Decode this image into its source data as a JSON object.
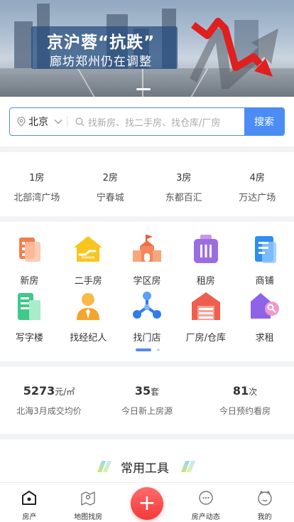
{
  "banner": {
    "headline": "京沪蓉“抗跌”",
    "subline": "廊坊郑州仍在调整"
  },
  "search": {
    "city": "北京",
    "placeholder": "找新房、找二手房、找仓库/厂房",
    "button": "搜索"
  },
  "hot": [
    {
      "rank": "1房",
      "name": "北部湾广场"
    },
    {
      "rank": "2房",
      "name": "宁春城"
    },
    {
      "rank": "3房",
      "name": "东都百汇"
    },
    {
      "rank": "4房",
      "name": "万达广场"
    }
  ],
  "categories": [
    {
      "label": "新房",
      "icon": "new-house-icon"
    },
    {
      "label": "二手房",
      "icon": "second-hand-house-icon"
    },
    {
      "label": "学区房",
      "icon": "school-district-icon"
    },
    {
      "label": "租房",
      "icon": "rent-icon"
    },
    {
      "label": "商铺",
      "icon": "shop-icon"
    },
    {
      "label": "写字楼",
      "icon": "office-building-icon"
    },
    {
      "label": "找经纪人",
      "icon": "agent-icon"
    },
    {
      "label": "找门店",
      "icon": "store-icon"
    },
    {
      "label": "厂房/仓库",
      "icon": "warehouse-icon"
    },
    {
      "label": "求租",
      "icon": "want-rent-icon"
    }
  ],
  "stats": [
    {
      "value": "5273",
      "unit": "元/㎡",
      "label": "北海3月成交均价"
    },
    {
      "value": "35",
      "unit": "套",
      "label": "今日新上房源"
    },
    {
      "value": "81",
      "unit": "次",
      "label": "今日预约看房"
    }
  ],
  "tools": {
    "title": "常用工具"
  },
  "tabbar": [
    {
      "label": "房产",
      "icon": "home-icon"
    },
    {
      "label": "地图找房",
      "icon": "map-icon"
    },
    {
      "label": "",
      "icon": "plus-icon"
    },
    {
      "label": "房产动态",
      "icon": "chat-icon"
    },
    {
      "label": "我的",
      "icon": "profile-icon"
    }
  ],
  "colors": {
    "accent": "#4b8cf5",
    "plus_button": "#f23a3a",
    "page_bg": "#f2f3f5"
  }
}
